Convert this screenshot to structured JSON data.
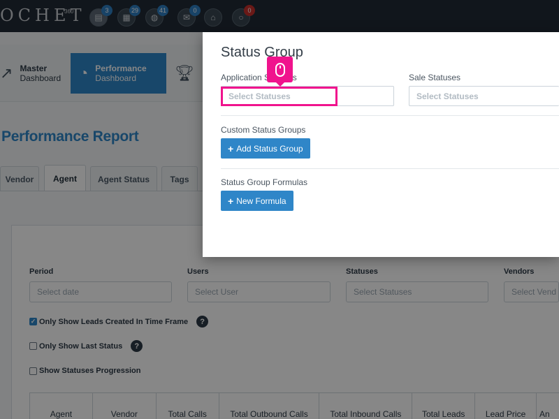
{
  "brand": {
    "text": "OCHET",
    "sup": "360"
  },
  "nav_badges": [
    "3",
    "29",
    "41",
    "0",
    "0"
  ],
  "nav_icons": [
    "document-icon",
    "report-icon",
    "chat-icon",
    "mail-icon",
    "inbox-icon",
    "comment-icon"
  ],
  "dashboards": [
    {
      "line1": "Master",
      "line2": "Dashboard"
    },
    {
      "line1": "Performance",
      "line2": "Dashboard"
    }
  ],
  "report_title": "Performance Report",
  "tabs": [
    "Vendor",
    "Agent",
    "Agent Status",
    "Tags"
  ],
  "filters": {
    "period_label": "Period",
    "period_placeholder": "Select date",
    "users_label": "Users",
    "users_placeholder": "Select User",
    "statuses_label": "Statuses",
    "statuses_placeholder": "Select Statuses",
    "vendors_label": "Vendors",
    "vendors_placeholder": "Select Vend"
  },
  "checkboxes": [
    {
      "label": "Only Show Leads Created In Time Frame",
      "checked": true
    },
    {
      "label": "Only Show Last Status",
      "checked": false
    },
    {
      "label": "Show Statuses Progression",
      "checked": false
    }
  ],
  "table_headers": [
    "Agent",
    "Vendor",
    "Total Calls",
    "Total Outbound Calls",
    "Total Inbound Calls",
    "Total Leads",
    "Lead Price",
    "An"
  ],
  "modal": {
    "title": "Status Group",
    "application_statuses_label": "Application Statuses",
    "application_statuses_placeholder": "Select Statuses",
    "sale_statuses_label": "Sale Statuses",
    "sale_statuses_placeholder": "Select Statuses",
    "custom_groups_label": "Custom Status Groups",
    "add_group_button": "Add Status Group",
    "formulas_label": "Status Group Formulas",
    "new_formula_button": "New Formula"
  },
  "colors": {
    "accent": "#2f86c8",
    "highlight": "#f0138d",
    "topbar": "#212b35"
  }
}
